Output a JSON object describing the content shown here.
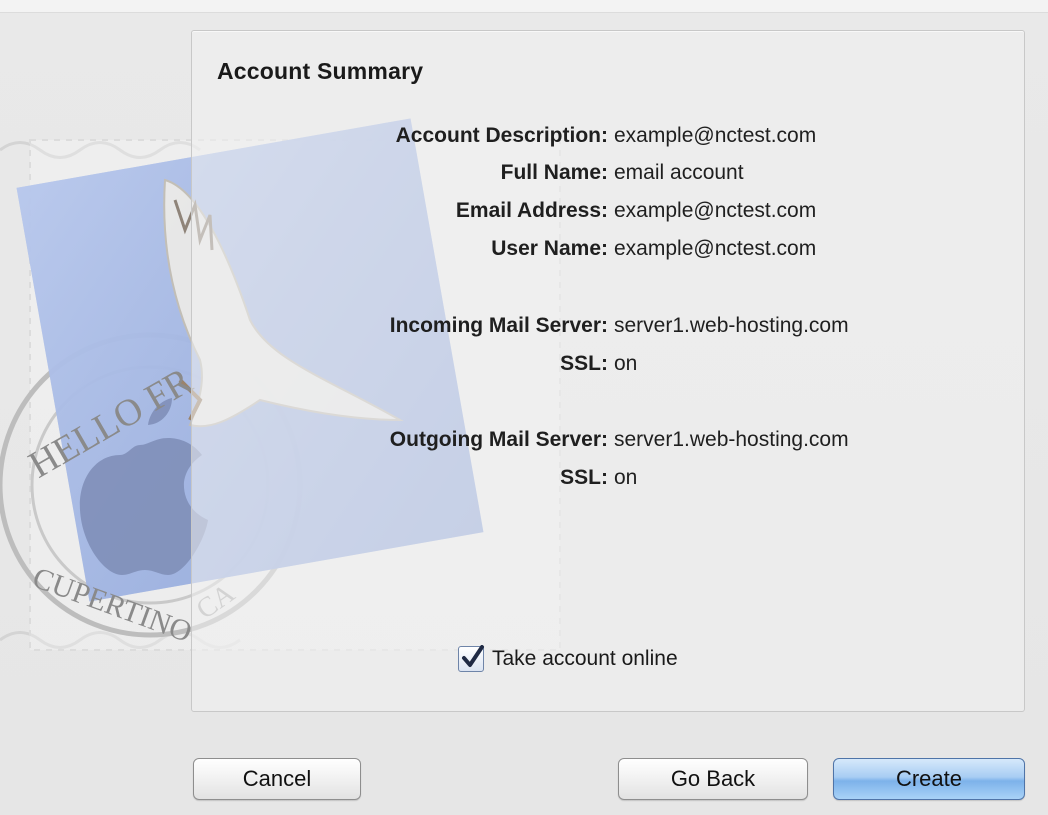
{
  "panel": {
    "title": "Account Summary"
  },
  "account": {
    "description_label": "Account Description:",
    "description_value": "example@nctest.com",
    "full_name_label": "Full Name:",
    "full_name_value": "email account",
    "email_label": "Email Address:",
    "email_value": "example@nctest.com",
    "user_name_label": "User Name:",
    "user_name_value": "example@nctest.com"
  },
  "incoming": {
    "server_label": "Incoming Mail Server:",
    "server_value": "server1.web-hosting.com",
    "ssl_label": "SSL:",
    "ssl_value": "on"
  },
  "outgoing": {
    "server_label": "Outgoing Mail Server:",
    "server_value": "server1.web-hosting.com",
    "ssl_label": "SSL:",
    "ssl_value": "on"
  },
  "options": {
    "take_online_label": "Take account online",
    "take_online_checked": true
  },
  "stamp": {
    "postmark_top": "HELLO FR",
    "postmark_bottom": "CUPERTINO",
    "postmark_suffix": "CA"
  },
  "buttons": {
    "cancel": "Cancel",
    "go_back": "Go Back",
    "create": "Create"
  },
  "colors": {
    "create_button": "#7db2ea",
    "checkbox_check": "#1f2a44"
  }
}
